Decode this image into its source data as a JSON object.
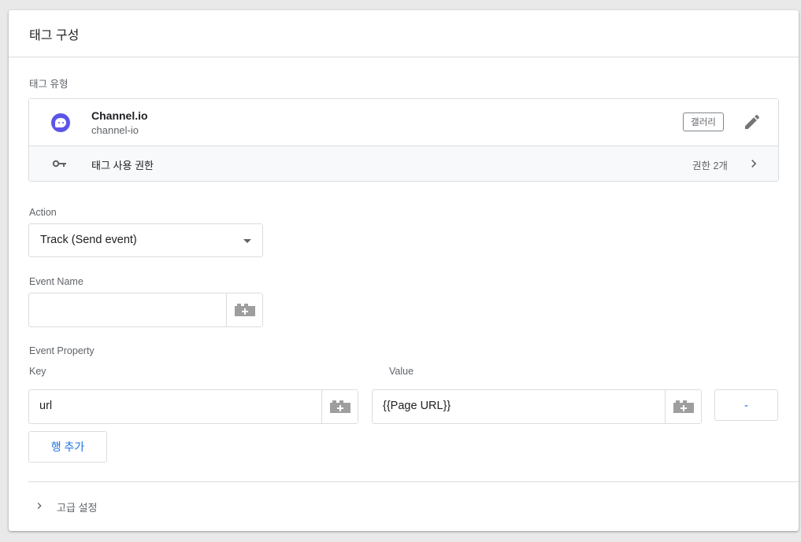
{
  "card": {
    "title": "태그 구성"
  },
  "tag_type": {
    "label": "태그 유형",
    "tag": {
      "name": "Channel.io",
      "id": "channel-io",
      "icon": "channel-io-logo-icon",
      "brand_color": "#5b55e8"
    },
    "gallery_label": "갤러리",
    "permissions": {
      "label": "태그 사용 권한",
      "count": "권한 2개"
    }
  },
  "action": {
    "label": "Action",
    "selected": "Track (Send event)"
  },
  "event_name": {
    "label": "Event Name",
    "value": ""
  },
  "event_property": {
    "label": "Event Property",
    "key_header": "Key",
    "value_header": "Value",
    "rows": [
      {
        "key": "url",
        "value": "{{Page URL}}"
      }
    ],
    "remove_label": "-",
    "add_row_label": "행 추가"
  },
  "advanced": {
    "label": "고급 설정"
  },
  "colors": {
    "accent": "#1a73e8",
    "border": "#dadce0",
    "muted_text": "#5f6368"
  }
}
